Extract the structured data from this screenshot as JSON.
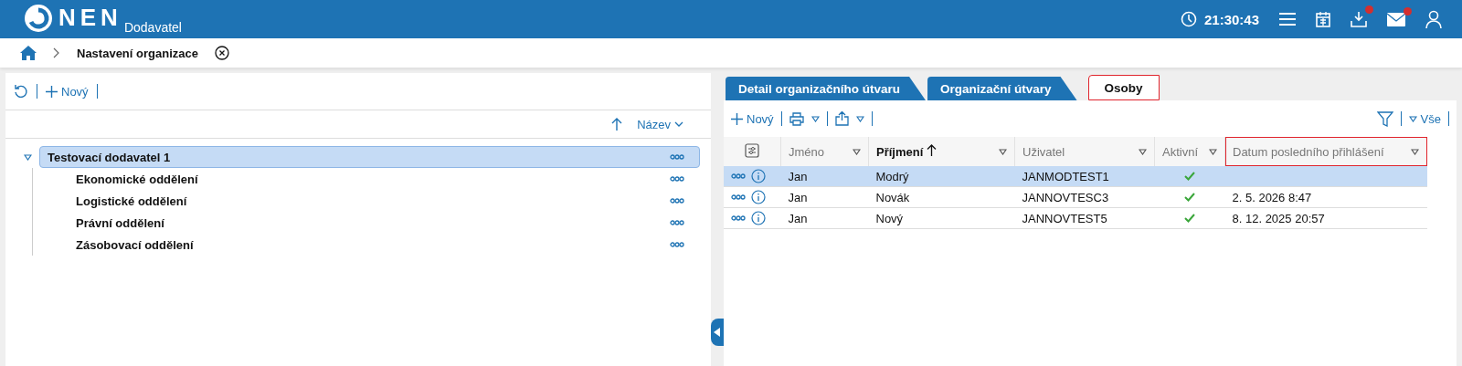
{
  "header": {
    "logo": "NEN",
    "subtitle": "Dodavatel",
    "time": "21:30:43",
    "downloads_badge": true,
    "mail_badge": true
  },
  "breadcrumb": {
    "current": "Nastavení organizace"
  },
  "tree_panel": {
    "toolbar": {
      "new": "Nový"
    },
    "sort": {
      "label": "Název"
    },
    "tree": [
      {
        "label": "Testovací dodavatel 1",
        "selected": true,
        "expanded": true,
        "children": [
          {
            "label": "Ekonomické oddělení",
            "selected": false
          },
          {
            "label": "Logistické oddělení",
            "selected": false
          },
          {
            "label": "Právní oddělení",
            "selected": false
          },
          {
            "label": "Zásobovací oddělení",
            "selected": false
          }
        ]
      }
    ]
  },
  "tabs": [
    {
      "label": "Detail organizačního útvaru",
      "selected": false,
      "highlighted": false
    },
    {
      "label": "Organizační útvary",
      "selected": false,
      "highlighted": false
    },
    {
      "label": "Osoby",
      "selected": true,
      "highlighted": true
    }
  ],
  "toolbar": {
    "new": "Nový",
    "filter": "Vše"
  },
  "table": {
    "columns": [
      {
        "label": "Jméno",
        "sorted": false,
        "highlighted": false
      },
      {
        "label": "Příjmení",
        "sorted": true,
        "highlighted": false
      },
      {
        "label": "Uživatel",
        "sorted": false,
        "highlighted": false
      },
      {
        "label": "Aktivní",
        "sorted": false,
        "highlighted": false
      },
      {
        "label": "Datum posledního přihlášení",
        "sorted": false,
        "highlighted": true
      }
    ],
    "rows": [
      {
        "selected": true,
        "first_name": "Jan",
        "last_name": "Modrý",
        "user": "JANMODTEST1",
        "active": true
      },
      {
        "selected": false,
        "first_name": "Jan",
        "last_name": "Novák",
        "user": "JANNOVTESC3",
        "active": true,
        "last_login": "2. 5. 2026 8:47"
      },
      {
        "selected": false,
        "first_name": "Jan",
        "last_name": "Nový",
        "user": "JANNOVTEST5",
        "active": true,
        "last_login": "8. 12. 2025 20:57"
      }
    ]
  }
}
